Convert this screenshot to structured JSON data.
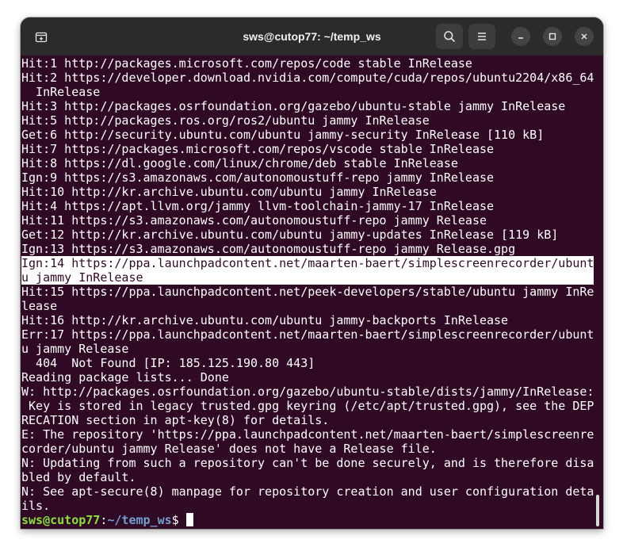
{
  "window": {
    "title": "sws@cutop77: ~/temp_ws"
  },
  "titlebar": {
    "icons": {
      "new_tab": "new-tab-icon",
      "search": "search-icon",
      "menu": "hamburger-menu-icon",
      "minimize": "minimize-icon",
      "maximize": "maximize-icon",
      "close": "close-icon"
    }
  },
  "colors": {
    "terminal_bg": "#300a24",
    "titlebar_bg": "#2b2b2b",
    "prompt_user": "#8ae234",
    "prompt_path": "#729fcf",
    "text": "#ffffff"
  },
  "terminal": {
    "lines": [
      "Hit:1 http://packages.microsoft.com/repos/code stable InRelease",
      "Hit:2 https://developer.download.nvidia.com/compute/cuda/repos/ubuntu2204/x86_64",
      "  InRelease",
      "Hit:3 http://packages.osrfoundation.org/gazebo/ubuntu-stable jammy InRelease",
      "Hit:5 http://packages.ros.org/ros2/ubuntu jammy InRelease",
      "Get:6 http://security.ubuntu.com/ubuntu jammy-security InRelease [110 kB]",
      "Hit:7 https://packages.microsoft.com/repos/vscode stable InRelease",
      "Hit:8 https://dl.google.com/linux/chrome/deb stable InRelease",
      "Ign:9 https://s3.amazonaws.com/autonomoustuff-repo jammy InRelease",
      "Hit:10 http://kr.archive.ubuntu.com/ubuntu jammy InRelease",
      "Hit:4 https://apt.llvm.org/jammy llvm-toolchain-jammy-17 InRelease",
      "Hit:11 https://s3.amazonaws.com/autonomoustuff-repo jammy Release",
      "Get:12 http://kr.archive.ubuntu.com/ubuntu jammy-updates InRelease [119 kB]",
      "Ign:13 https://s3.amazonaws.com/autonomoustuff-repo jammy Release.gpg",
      "Ign:14 https://ppa.launchpadcontent.net/maarten-baert/simplescreenrecorder/ubunt",
      "u jammy InRelease",
      "Hit:15 https://ppa.launchpadcontent.net/peek-developers/stable/ubuntu jammy InRe",
      "lease",
      "Hit:16 http://kr.archive.ubuntu.com/ubuntu jammy-backports InRelease",
      "Err:17 https://ppa.launchpadcontent.net/maarten-baert/simplescreenrecorder/ubunt",
      "u jammy Release",
      "  404  Not Found [IP: 185.125.190.80 443]",
      "Reading package lists... Done",
      "W: http://packages.osrfoundation.org/gazebo/ubuntu-stable/dists/jammy/InRelease:",
      " Key is stored in legacy trusted.gpg keyring (/etc/apt/trusted.gpg), see the DEP",
      "RECATION section in apt-key(8) for details.",
      "E: The repository 'https://ppa.launchpadcontent.net/maarten-baert/simplescreenre",
      "corder/ubuntu jammy Release' does not have a Release file.",
      "N: Updating from such a repository can't be done securely, and is therefore disa",
      "bled by default.",
      "N: See apt-secure(8) manpage for repository creation and user configuration deta",
      "ils."
    ],
    "highlighted_line_indices": [
      14,
      15
    ],
    "prompt": {
      "user_host": "sws@cutop77",
      "separator": ":",
      "path": "~/temp_ws",
      "symbol": "$ "
    }
  }
}
